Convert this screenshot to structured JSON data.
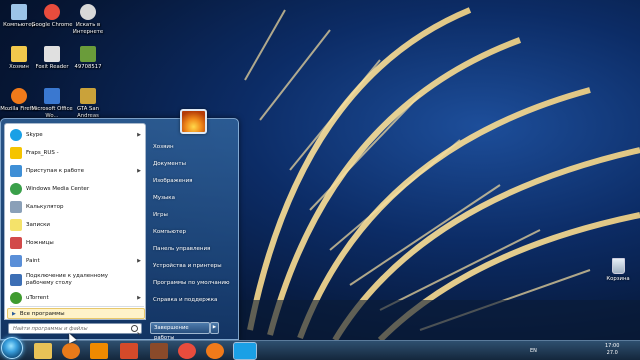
{
  "desktop": {
    "icons": [
      {
        "label": "Компьютер",
        "icon": "computer-icon",
        "color": "#9cc4e8"
      },
      {
        "label": "Google Chrome",
        "icon": "chrome-icon",
        "color": "#e84c3d"
      },
      {
        "label": "Искать в Интернете",
        "icon": "search-web-icon",
        "color": "#d8d8d8"
      },
      {
        "label": "Хозяин",
        "icon": "user-folder-icon",
        "color": "#f2c94c"
      },
      {
        "label": "Foxit Reader",
        "icon": "foxit-reader-icon",
        "color": "#e0e0e0"
      },
      {
        "label": "49708517",
        "icon": "image-file-icon",
        "color": "#6a9c3a"
      },
      {
        "label": "Mozilla Firefox",
        "icon": "firefox-icon",
        "color": "#f07a1a"
      },
      {
        "label": "Microsoft Office Wo...",
        "icon": "word-icon",
        "color": "#3a78d0"
      },
      {
        "label": "GTA San Andreas",
        "icon": "gta-icon",
        "color": "#caa23a"
      }
    ],
    "recycle_bin": {
      "label": "Корзина",
      "icon": "recycle-bin-icon"
    }
  },
  "start_menu": {
    "programs": [
      {
        "label": "Skype",
        "icon": "skype-icon",
        "color": "#1aa0e6",
        "arrow": "▶"
      },
      {
        "label": "Fraps_RUS -",
        "icon": "fraps-icon",
        "color": "#f5c400",
        "arrow": ""
      },
      {
        "label": "Приступая к работе",
        "icon": "getting-started-icon",
        "color": "#3f8fd6",
        "arrow": "▶"
      },
      {
        "label": "Windows Media Center",
        "icon": "media-center-icon",
        "color": "#3aa04a",
        "arrow": ""
      },
      {
        "label": "Калькулятор",
        "icon": "calculator-icon",
        "color": "#8aa0b8",
        "arrow": ""
      },
      {
        "label": "Записки",
        "icon": "sticky-notes-icon",
        "color": "#f4e26a",
        "arrow": ""
      },
      {
        "label": "Ножницы",
        "icon": "snipping-tool-icon",
        "color": "#d24a4a",
        "arrow": ""
      },
      {
        "label": "Paint",
        "icon": "paint-icon",
        "color": "#5a8fd8",
        "arrow": "▶"
      },
      {
        "label": "Подключение к удаленному рабочему столу",
        "icon": "remote-desktop-icon",
        "color": "#3d6fb5",
        "arrow": ""
      },
      {
        "label": "uTorrent",
        "icon": "utorrent-icon",
        "color": "#3f9b2f",
        "arrow": "▶"
      }
    ],
    "all_programs": "Все программы",
    "all_programs_arrow": "▶",
    "search_placeholder": "Найти программы и файлы",
    "places": [
      "Хозяин",
      "Документы",
      "Изображения",
      "Музыка",
      "Игры",
      "Компьютер",
      "Панель управления",
      "Устройства и принтеры",
      "Программы по умолчанию",
      "Справка и поддержка"
    ],
    "shutdown_label": "Завершение работы",
    "shutdown_arrow": "▶"
  },
  "taskbar": {
    "pinned": [
      {
        "icon": "explorer-icon",
        "color": "#e8c257",
        "active": false
      },
      {
        "icon": "media-player-icon",
        "color": "#e87a1a",
        "active": false
      },
      {
        "icon": "vlc-icon",
        "color": "#f08a00",
        "active": false
      },
      {
        "icon": "app-icon",
        "color": "#d44a2a",
        "active": false
      },
      {
        "icon": "game-icon",
        "color": "#8a4a2a",
        "active": false
      },
      {
        "icon": "chrome-icon",
        "color": "#e84c3d",
        "active": false
      },
      {
        "icon": "firefox-icon",
        "color": "#f07a1a",
        "active": false
      },
      {
        "icon": "skype-icon",
        "color": "#1aa0e6",
        "active": true
      }
    ],
    "tray": {
      "language": "EN",
      "time": "17:00",
      "date": "27.0"
    }
  }
}
